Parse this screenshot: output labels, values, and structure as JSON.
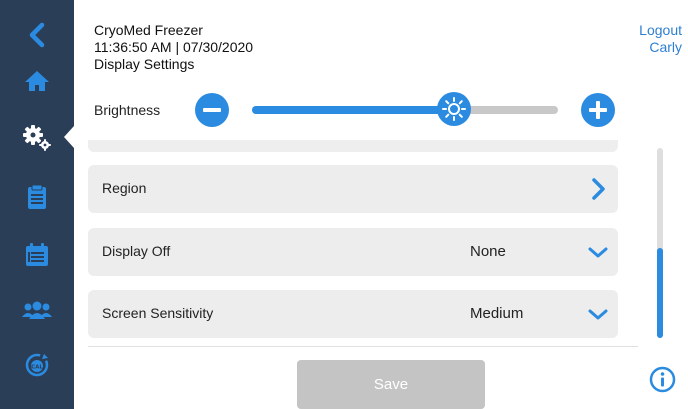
{
  "header": {
    "device_name": "CryoMed Freezer",
    "datetime": "11:36:50 AM | 07/30/2020",
    "page_title": "Display Settings"
  },
  "user": {
    "logout_label": "Logout",
    "username": "Carly"
  },
  "brightness": {
    "label": "Brightness",
    "level_fraction": 0.66
  },
  "settings_rows": [
    {
      "label": "Region",
      "value": "",
      "control": "chevron-right"
    },
    {
      "label": "Display Off",
      "value": "None",
      "control": "chevron-down"
    },
    {
      "label": "Screen Sensitivity",
      "value": "Medium",
      "control": "chevron-down"
    }
  ],
  "actions": {
    "save_label": "Save"
  },
  "sidebar": {
    "items": [
      {
        "icon": "back-icon"
      },
      {
        "icon": "home-icon"
      },
      {
        "icon": "settings-gears-icon",
        "active": true
      },
      {
        "icon": "clipboard-icon"
      },
      {
        "icon": "calendar-list-icon"
      },
      {
        "icon": "users-group-icon"
      },
      {
        "icon": "calibration-icon"
      }
    ]
  },
  "colors": {
    "sidebar_bg": "#2a3e58",
    "accent": "#2a8be0",
    "row_bg": "#ededed",
    "save_disabled": "#c4c4c4"
  }
}
